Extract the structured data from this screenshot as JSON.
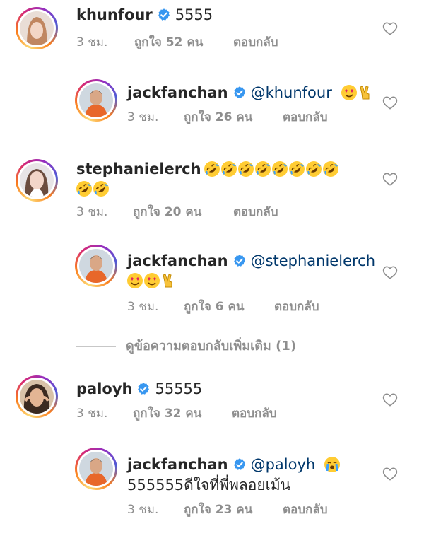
{
  "comments": [
    {
      "username": "khunfour",
      "verified": true,
      "text": "5555",
      "time": "3 ชม.",
      "likes": "ถูกใจ 52 คน",
      "reply": "ตอบกลับ"
    },
    {
      "username": "jackfanchan",
      "verified": true,
      "mention": "@khunfour",
      "emojis": [
        "heart-eyes-emoji",
        "victory-hand-emoji"
      ],
      "time": "3 ชม.",
      "likes": "ถูกใจ 26 คน",
      "reply": "ตอบกลับ"
    },
    {
      "username": "stephanielerch",
      "verified": false,
      "emojis_line1_count": 8,
      "emojis_line2_count": 2,
      "emoji_name": "rolling-on-floor-laughing-emoji",
      "time": "3 ชม.",
      "likes": "ถูกใจ 20 คน",
      "reply": "ตอบกลับ"
    },
    {
      "username": "jackfanchan",
      "verified": true,
      "mention": "@stephanielerch",
      "emojis": [
        "heart-eyes-emoji",
        "heart-eyes-emoji",
        "victory-hand-emoji"
      ],
      "time": "3 ชม.",
      "likes": "ถูกใจ 6 คน",
      "reply": "ตอบกลับ"
    },
    {
      "username": "paloyh",
      "verified": true,
      "text": "55555",
      "time": "3 ชม.",
      "likes": "ถูกใจ 32 คน",
      "reply": "ตอบกลับ"
    },
    {
      "username": "jackfanchan",
      "verified": true,
      "mention": "@paloyh",
      "emojis": [
        "loudly-crying-emoji"
      ],
      "text_line2": "555555ดีใจที่พี่พลอยเม้น",
      "time": "3 ชม.",
      "likes": "ถูกใจ 23 คน",
      "reply": "ตอบกลับ"
    }
  ],
  "more_replies": "ดูข้อความตอบกลับเพิ่มเติม (1)",
  "colors": {
    "verified_blue": "#3897f0",
    "mention": "#00376b",
    "meta_gray": "#8e8e8e"
  }
}
